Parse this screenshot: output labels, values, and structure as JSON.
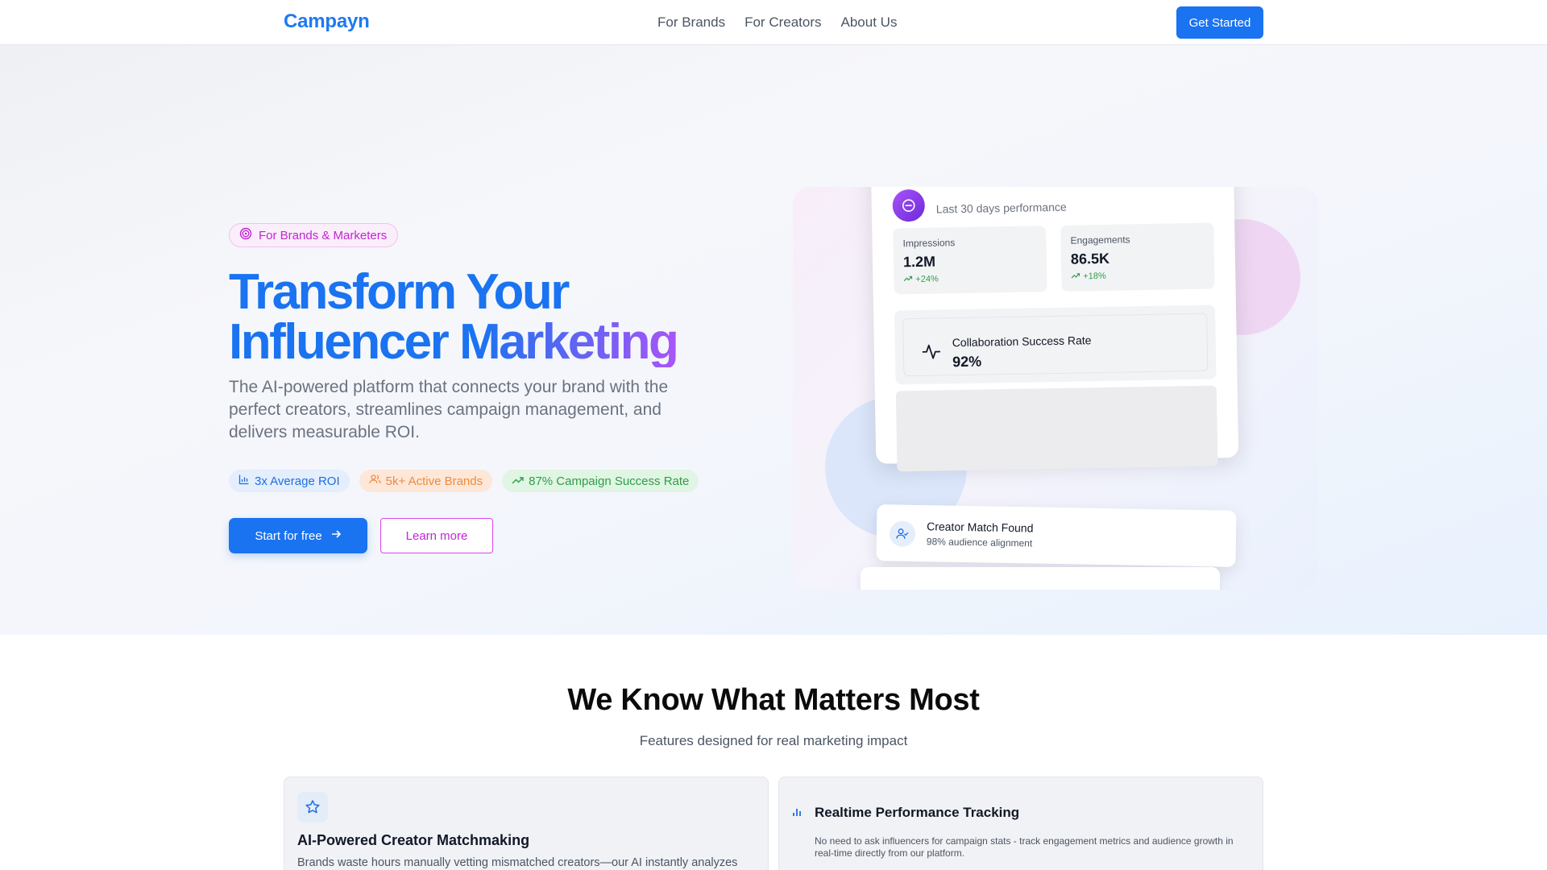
{
  "nav": {
    "logo": "Campayn",
    "links": [
      "For Brands",
      "For Creators",
      "About Us"
    ],
    "cta": "Get Started"
  },
  "hero": {
    "badge": "For Brands & Marketers",
    "title_line1": "Transform Your",
    "title_line2": "Influencer Marketing",
    "description": "The AI-powered platform that connects your brand with the perfect creators, streamlines campaign management, and delivers measurable ROI.",
    "stats": [
      {
        "label": "3x Average ROI",
        "icon": "bar-chart-icon",
        "color": "#1d6fe0"
      },
      {
        "label": "5k+ Active Brands",
        "icon": "users-icon",
        "color": "#f08a3c"
      },
      {
        "label": "87% Campaign Success Rate",
        "icon": "trending-up-icon",
        "color": "#2f9e47"
      }
    ],
    "primary_button": "Start for free",
    "secondary_button": "Learn more"
  },
  "dashboard": {
    "subtitle": "Last 30 days performance",
    "metrics": [
      {
        "label": "Impressions",
        "value": "1.2M",
        "change": "+24%"
      },
      {
        "label": "Engagements",
        "value": "86.5K",
        "change": "+18%"
      }
    ],
    "collab_label": "Collaboration Success Rate",
    "collab_value": "92%",
    "match_title": "Creator Match Found",
    "match_sub": "98% audience alignment"
  },
  "features": {
    "title": "We Know What Matters Most",
    "subtitle": "Features designed for real marketing impact",
    "cards": [
      {
        "icon": "star-icon",
        "title": "AI-Powered Creator Matchmaking",
        "description": "Brands waste hours manually vetting mismatched creators—our AI instantly analyzes"
      },
      {
        "icon": "bar-chart-icon",
        "title": "Realtime Performance Tracking",
        "description": "No need to ask influencers for campaign stats - track engagement metrics and audience growth in real-time directly from our platform."
      }
    ]
  },
  "colors": {
    "brand_blue": "#1a73f0",
    "accent_purple": "#a855f7",
    "accent_magenta": "#c026d3"
  }
}
